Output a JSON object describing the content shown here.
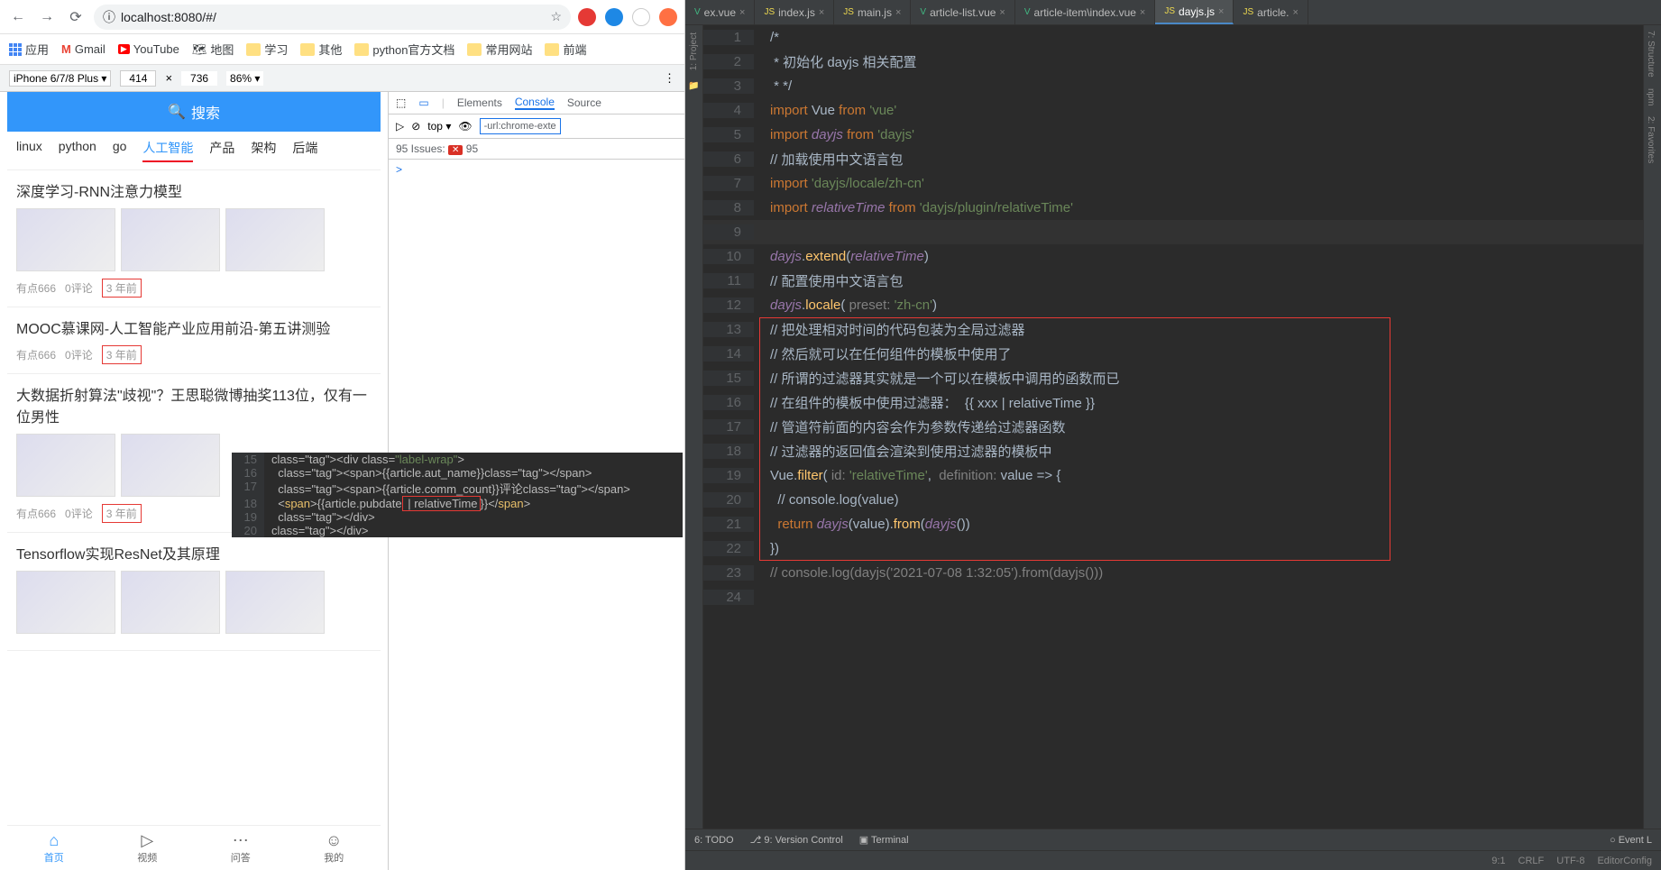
{
  "browser": {
    "url": "localhost:8080/#/",
    "bookmarks": [
      {
        "label": "应用",
        "type": "apps"
      },
      {
        "label": "Gmail",
        "type": "gmail"
      },
      {
        "label": "YouTube",
        "type": "youtube"
      },
      {
        "label": "地图",
        "type": "maps"
      },
      {
        "label": "学习",
        "type": "folder"
      },
      {
        "label": "其他",
        "type": "folder"
      },
      {
        "label": "python官方文档",
        "type": "folder"
      },
      {
        "label": "常用网站",
        "type": "folder"
      },
      {
        "label": "前端",
        "type": "folder"
      }
    ],
    "device": "iPhone 6/7/8 Plus ▾",
    "dim_w": "414",
    "dim_h": "736",
    "zoom": "86% ▾"
  },
  "app": {
    "search_label": "搜索",
    "tabs": [
      "linux",
      "python",
      "go",
      "人工智能",
      "产品",
      "架构",
      "后端"
    ],
    "active_tab": 3,
    "articles": [
      {
        "title": "深度学习-RNN注意力模型",
        "author": "有点666",
        "comments": "0评论",
        "date": "3 年前",
        "thumbs": 3
      },
      {
        "title": "MOOC慕课网-人工智能产业应用前沿-第五讲测验",
        "author": "有点666",
        "comments": "0评论",
        "date": "3 年前",
        "thumbs": 0
      },
      {
        "title": "大数据折射算法\"歧视\"？王思聪微博抽奖113位，仅有一位男性",
        "author": "有点666",
        "comments": "0评论",
        "date": "3 年前",
        "thumbs": 2
      },
      {
        "title": "Tensorflow实现ResNet及其原理",
        "author": "",
        "comments": "",
        "date": "",
        "thumbs": 3
      }
    ],
    "bottom_nav": [
      {
        "icon": "⌂",
        "label": "首页"
      },
      {
        "icon": "▷",
        "label": "视频"
      },
      {
        "icon": "⋯",
        "label": "问答"
      },
      {
        "icon": "☺",
        "label": "我的"
      }
    ]
  },
  "devtools": {
    "tabs": [
      "Elements",
      "Console",
      "Source"
    ],
    "active": "Console",
    "scope": "top ▾",
    "filter": "-url:chrome-exte",
    "issues": "95 Issues:",
    "issues_count": "95",
    "prompt": ">"
  },
  "overlay": {
    "start": 15,
    "lines": [
      "<div class=\"label-wrap\">",
      "  <span>{{article.aut_name}}</span>",
      "  <span>{{article.comm_count}}评论</span>",
      "  <span>{{article.pubdate | relativeTime}}</span>",
      "  </div>",
      "</div>"
    ]
  },
  "ide": {
    "tabs": [
      {
        "name": "ex.vue",
        "type": "vue"
      },
      {
        "name": "index.js",
        "type": "js"
      },
      {
        "name": "main.js",
        "type": "js"
      },
      {
        "name": "article-list.vue",
        "type": "vue"
      },
      {
        "name": "article-item\\index.vue",
        "type": "vue"
      },
      {
        "name": "dayjs.js",
        "type": "js",
        "active": true
      },
      {
        "name": "article.",
        "type": "js"
      }
    ],
    "left_rail": [
      "1: Project"
    ],
    "right_rail": [
      "7: Structure",
      "npm",
      "2: Favorites"
    ],
    "code": [
      {
        "n": 1,
        "t": "/*",
        "cls": "cm"
      },
      {
        "n": 2,
        "t": " * 初始化 dayjs 相关配置",
        "cls": "cm"
      },
      {
        "n": 3,
        "t": " * */",
        "cls": "cm"
      },
      {
        "n": 4,
        "html": "<span class='kw2'>import</span> Vue <span class='kw2'>from</span> <span class='str2'>'vue'</span>"
      },
      {
        "n": 5,
        "html": "<span class='kw2'>import</span> <span class='id'>dayjs</span> <span class='kw2'>from</span> <span class='str2'>'dayjs'</span>"
      },
      {
        "n": 6,
        "t": "// 加载使用中文语言包",
        "cls": "cm"
      },
      {
        "n": 7,
        "html": "<span class='kw2'>import</span> <span class='str2'>'dayjs/locale/zh-cn'</span>"
      },
      {
        "n": 8,
        "html": "<span class='kw2'>import</span> <span class='id'>relativeTime</span> <span class='kw2'>from</span> <span class='str2'>'dayjs/plugin/relativeTime'</span>"
      },
      {
        "n": 9,
        "t": "",
        "current": true
      },
      {
        "n": 10,
        "html": "<span class='id'>dayjs</span>.<span class='fn'>extend</span>(<span class='id'>relativeTime</span>)"
      },
      {
        "n": 11,
        "t": "// 配置使用中文语言包",
        "cls": "cm"
      },
      {
        "n": 12,
        "html": "<span class='id'>dayjs</span>.<span class='fn'>locale</span>( <span class='param'>preset:</span> <span class='str2'>'zh-cn'</span>)"
      },
      {
        "n": 13,
        "t": "// 把处理相对时间的代码包装为全局过滤器",
        "cls": "cm"
      },
      {
        "n": 14,
        "t": "// 然后就可以在任何组件的模板中使用了",
        "cls": "cm"
      },
      {
        "n": 15,
        "t": "// 所谓的过滤器其实就是一个可以在模板中调用的函数而已",
        "cls": "cm"
      },
      {
        "n": 16,
        "t": "// 在组件的模板中使用过滤器：  {{ xxx | relativeTime }}",
        "cls": "cm"
      },
      {
        "n": 17,
        "t": "// 管道符前面的内容会作为参数传递给过滤器函数",
        "cls": "cm"
      },
      {
        "n": 18,
        "t": "// 过滤器的返回值会渲染到使用过滤器的模板中",
        "cls": "cm"
      },
      {
        "n": 19,
        "html": "Vue.<span class='fn'>filter</span>( <span class='param'>id:</span> <span class='str2'>'relativeTime'</span>,  <span class='param'>definition:</span> value =&gt; {"
      },
      {
        "n": 20,
        "t": "  // console.log(value)",
        "cls": "cm"
      },
      {
        "n": 21,
        "html": "  <span class='kw2'>return</span> <span class='id'>dayjs</span>(value).<span class='fn'>from</span>(<span class='id'>dayjs</span>())"
      },
      {
        "n": 22,
        "t": "})"
      },
      {
        "n": 23,
        "html": "<span class='cm'>// console.log(dayjs('2021-07-08 1:32:05').from(dayjs()))</span>"
      },
      {
        "n": 24,
        "t": ""
      }
    ],
    "bottom": {
      "todo": "6: TODO",
      "vc": "9: Version Control",
      "term": "Terminal",
      "event": "Event L"
    },
    "status": {
      "pos": "9:1",
      "enc": "CRLF",
      "cs": "UTF-8",
      "ec": "EditorConfig"
    }
  }
}
